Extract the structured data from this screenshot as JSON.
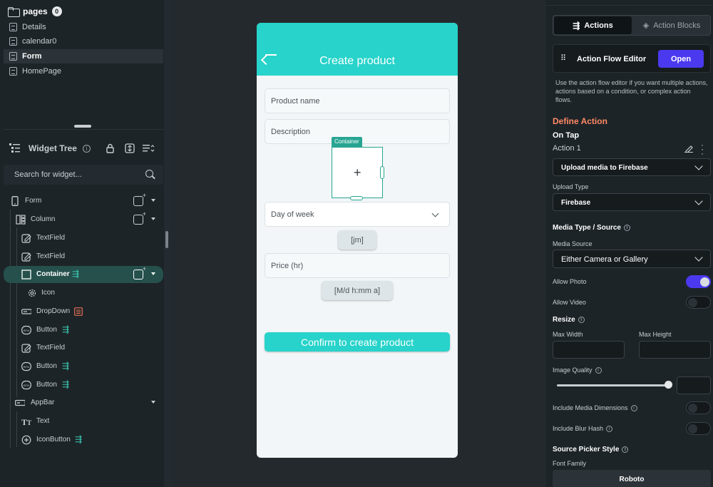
{
  "pages": {
    "header": "pages",
    "count": "0",
    "items": [
      {
        "label": "Details"
      },
      {
        "label": "calendar0"
      },
      {
        "label": "Form"
      },
      {
        "label": "HomePage"
      }
    ]
  },
  "widget_tree": {
    "title": "Widget Tree",
    "search_placeholder": "Search for widget...",
    "nodes": [
      {
        "label": "Form"
      },
      {
        "label": "Column"
      },
      {
        "label": "TextField"
      },
      {
        "label": "TextField"
      },
      {
        "label": "Container"
      },
      {
        "label": "Icon"
      },
      {
        "label": "DropDown"
      },
      {
        "label": "Button"
      },
      {
        "label": "TextField"
      },
      {
        "label": "Button"
      },
      {
        "label": "Button"
      },
      {
        "label": "AppBar"
      },
      {
        "label": "Text"
      },
      {
        "label": "IconButton"
      }
    ]
  },
  "phone": {
    "appbar_title": "Create product",
    "product_name_placeholder": "Product name",
    "description_placeholder": "Description",
    "container_tag": "Container",
    "container_plus": "+",
    "dropdown_placeholder": "Day of week",
    "chip_time": "[jm]",
    "price_placeholder": "Price (hr)",
    "chip_datetime": "[M/d h:mm a]",
    "confirm_label": "Confirm to create product",
    "accent_color": "#27d3ca"
  },
  "properties": {
    "tabs": {
      "actions": "Actions",
      "action_blocks": "Action Blocks"
    },
    "action_flow_editor": {
      "label": "Action Flow Editor",
      "button": "Open"
    },
    "help_text": "Use the action flow editor if you want multiple actions, actions based on a condition, or complex action flows.",
    "define_action": "Define Action",
    "on_tap": "On Tap",
    "action_name": "Action 1",
    "action_type": "Upload media to Firebase",
    "upload_type_label": "Upload Type",
    "upload_type_value": "Firebase",
    "media_type_source": "Media Type / Source",
    "media_source_label": "Media Source",
    "media_source_value": "Either Camera or Gallery",
    "allow_photo": {
      "label": "Allow Photo",
      "on": true
    },
    "allow_video": {
      "label": "Allow Video",
      "on": false
    },
    "resize": "Resize",
    "max_width": "Max Width",
    "max_height": "Max Height",
    "image_quality": "Image Quality",
    "image_quality_level": 1.0,
    "include_media_dimensions": {
      "label": "Include Media Dimensions",
      "on": false
    },
    "include_blur_hash": {
      "label": "Include Blur Hash",
      "on": false
    },
    "source_picker_style": "Source Picker Style",
    "font_family_label": "Font Family",
    "font_family_value": "Roboto",
    "brand_color": "#4b39ef",
    "heading_color": "#ff8a65"
  }
}
